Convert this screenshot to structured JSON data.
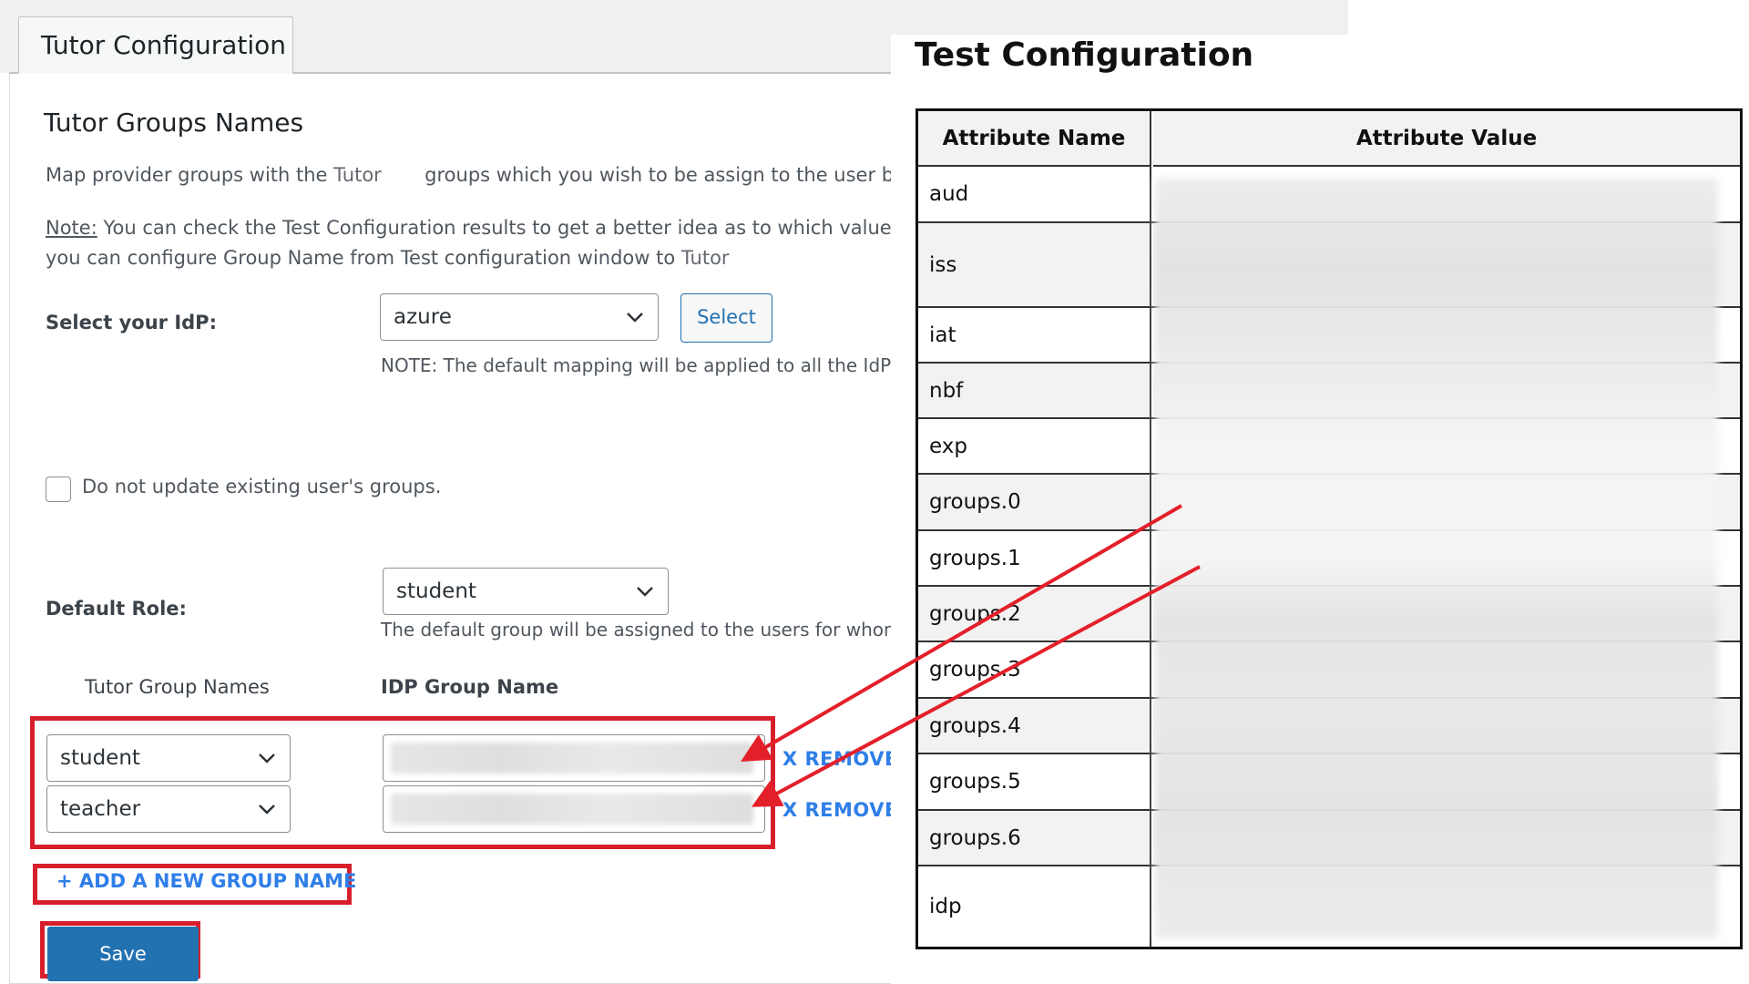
{
  "tabs": {
    "active_label": "Tutor Configuration"
  },
  "left": {
    "heading": "Tutor Groups Names",
    "description_start": "Map provider groups with the",
    "description_tutor": "Tutor",
    "description_end": "groups which you wish to be assign to the user based c",
    "note_label": "Note:",
    "note_line1": " You can check the Test Configuration results to get a better idea as to which values to map",
    "note_line2": "you can configure Group Name from Test configuration window to",
    "note_tutor": "Tutor",
    "idp_label": "Select your IdP:",
    "idp_value": "azure",
    "select_button": "Select",
    "idp_note": "NOTE: The default mapping will be applied to all the IdPs",
    "checkbox_label": "Do not update existing user's groups.",
    "default_role_label": "Default Role:",
    "default_role_value": "student",
    "default_role_note": "The default group will be assigned to the users for whom",
    "col_tutor_groups": "Tutor Group Names",
    "col_idp_group": "IDP Group Name",
    "mappings": [
      {
        "tutor_group": "student",
        "remove_label": "X REMOVE"
      },
      {
        "tutor_group": "teacher",
        "remove_label": "X REMOVE"
      }
    ],
    "add_group_label": "+ ADD A NEW GROUP NAME",
    "save_label": "Save"
  },
  "right": {
    "title": "Test Configuration",
    "col_name": "Attribute Name",
    "col_value": "Attribute Value",
    "rows": [
      {
        "name": "aud"
      },
      {
        "name": "iss"
      },
      {
        "name": "iat"
      },
      {
        "name": "nbf"
      },
      {
        "name": "exp"
      },
      {
        "name": "groups.0"
      },
      {
        "name": "groups.1"
      },
      {
        "name": "groups.2"
      },
      {
        "name": "groups.3"
      },
      {
        "name": "groups.4"
      },
      {
        "name": "groups.5"
      },
      {
        "name": "groups.6"
      },
      {
        "name": "idp"
      }
    ]
  },
  "colors": {
    "highlight_red": "#d71f2c",
    "arrow_red": "#e3202a",
    "link_blue": "#2f7ee8",
    "button_blue": "#2271b1"
  }
}
